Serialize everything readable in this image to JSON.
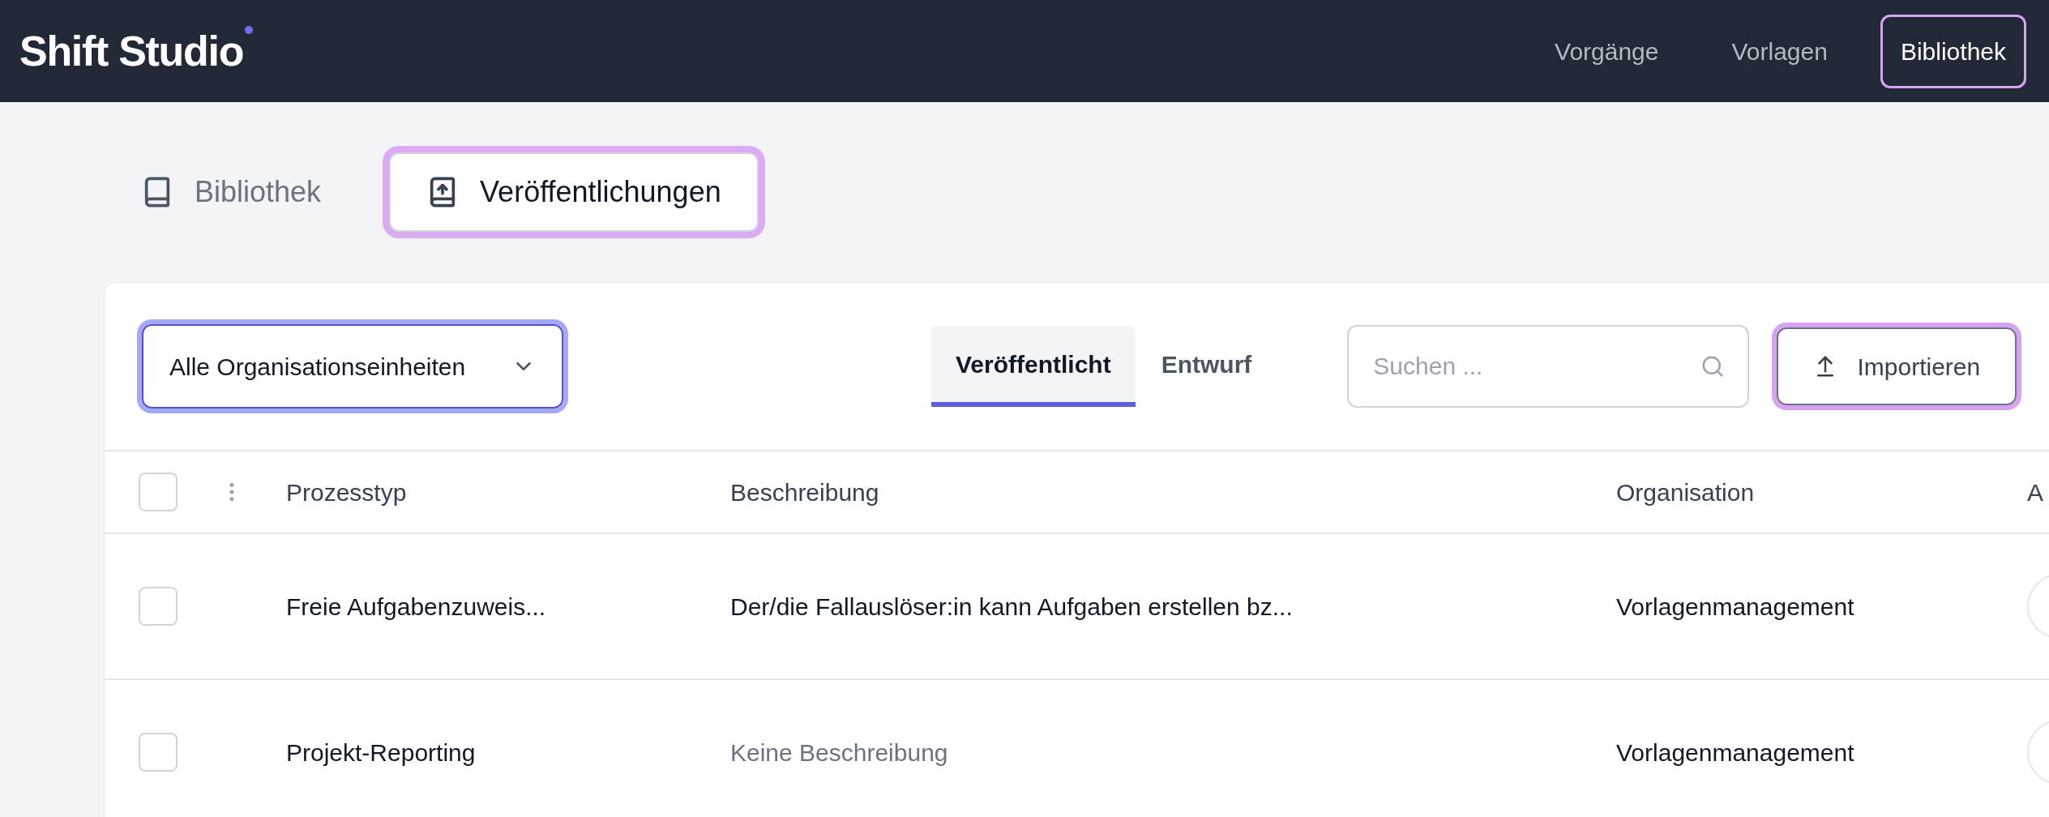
{
  "header": {
    "logo": "Shift Studio",
    "nav": [
      {
        "label": "Vorgänge",
        "selected": false
      },
      {
        "label": "Vorlagen",
        "selected": false
      },
      {
        "label": "Bibliothek",
        "selected": true
      }
    ]
  },
  "view_tabs": [
    {
      "label": "Bibliothek",
      "selected": false,
      "kind": "book"
    },
    {
      "label": "Veröffentlichungen",
      "selected": true,
      "kind": "publish"
    }
  ],
  "toolbar": {
    "org_select": {
      "value": "Alle Organisationseinheiten"
    },
    "status_tabs": [
      {
        "label": "Veröffentlicht",
        "selected": true
      },
      {
        "label": "Entwurf",
        "selected": false
      }
    ],
    "search": {
      "placeholder": "Suchen ..."
    },
    "import_button": "Importieren"
  },
  "table": {
    "all_checked": false,
    "columns": [
      "Prozesstyp",
      "Beschreibung",
      "Organisation",
      "A"
    ],
    "rows": [
      {
        "checked": false,
        "process_type": "Freie Aufgabenzuweis...",
        "description": "Der/die Fallauslöser:in kann Aufgaben erstellen bz...",
        "description_muted": false,
        "organisation": "Vorlagenmanagement"
      },
      {
        "checked": false,
        "process_type": "Projekt-Reporting",
        "description": "Keine Beschreibung",
        "description_muted": true,
        "organisation": "Vorlagenmanagement"
      }
    ]
  }
}
